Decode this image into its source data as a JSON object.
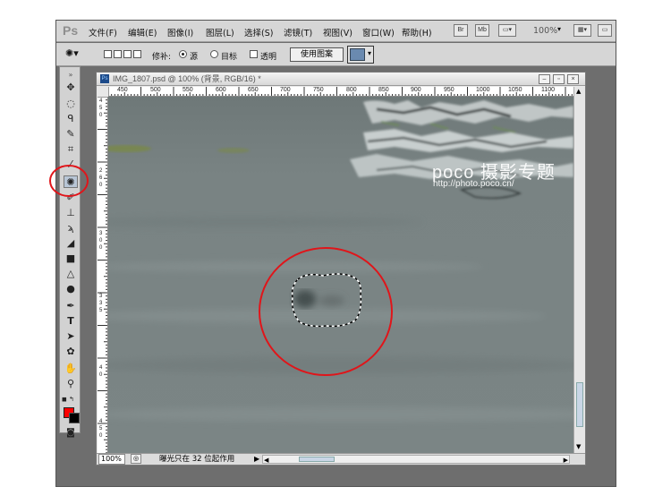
{
  "app": {
    "logo": "Ps"
  },
  "menu": {
    "items": [
      "文件(F)",
      "编辑(E)",
      "图像(I)",
      "图层(L)",
      "选择(S)",
      "滤镜(T)",
      "视图(V)",
      "窗口(W)",
      "帮助(H)"
    ],
    "bridge_label": "Br",
    "mini_bridge_label": "Mb",
    "zoom_level": "100%"
  },
  "options": {
    "repair_label": "修补:",
    "source_label": "源",
    "target_label": "目标",
    "transparent_label": "透明",
    "use_pattern_label": "使用图案",
    "source_selected": true
  },
  "document": {
    "title": "IMG_1807.psd @ 100% (背景, RGB/16) *",
    "ruler_h": [
      "450",
      "500",
      "550",
      "600",
      "650",
      "700",
      "750",
      "800",
      "850",
      "900",
      "950",
      "1000",
      "1050",
      "1100"
    ],
    "ruler_v": [
      "4",
      "5",
      "0",
      "2",
      "6",
      "0",
      "3",
      "0",
      "0",
      "3",
      "3",
      "5",
      "4",
      "0",
      "4",
      "5",
      "0"
    ]
  },
  "watermark": {
    "brand": "poco 摄影专题",
    "url": "http://photo.poco.cn/"
  },
  "status": {
    "zoom": "100%",
    "message": "曝光只在 32 位起作用"
  },
  "colors": {
    "foreground": "#ff0000",
    "background": "#000000",
    "annotation": "#e0151a"
  }
}
